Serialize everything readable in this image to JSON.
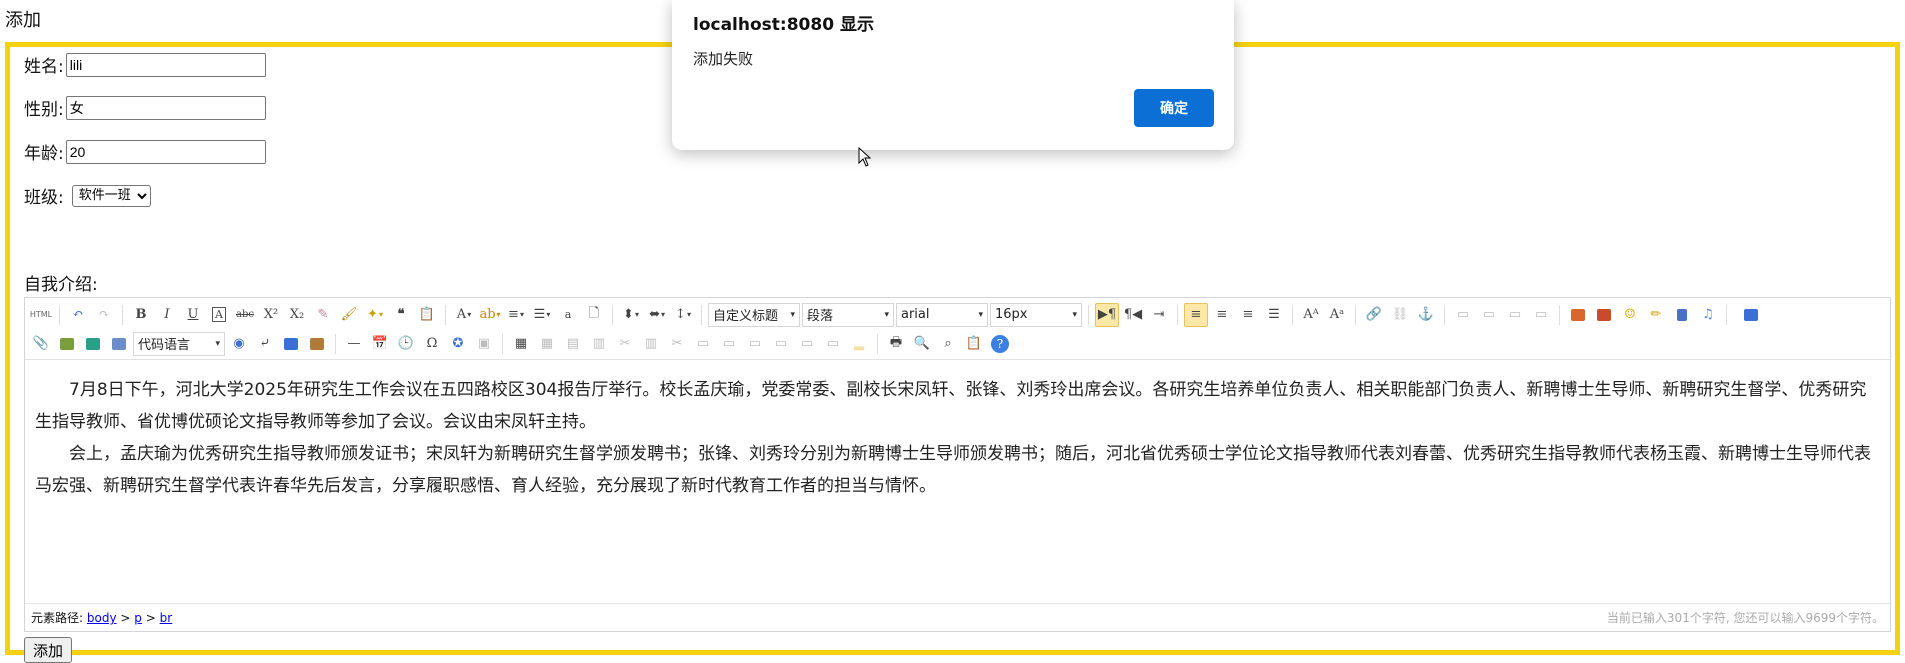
{
  "page": {
    "title": "添加"
  },
  "form": {
    "name_label": "姓名:",
    "name_value": "lili",
    "gender_label": "性别:",
    "gender_value": "女",
    "age_label": "年龄:",
    "age_value": "20",
    "class_label": "班级:",
    "class_selected": "软件一班",
    "intro_label": "自我介绍:",
    "submit_label": "添加",
    "frame_color": "#f5d20f"
  },
  "editor": {
    "toolbar": {
      "code_language_label": "代码语言",
      "custom_heading_label": "自定义标题",
      "paragraph_label": "段落",
      "font_family_label": "arial",
      "font_size_label": "16px",
      "html_icon_label": "HTML"
    },
    "content": {
      "paragraph1": "7月8日下午，河北大学2025年研究生工作会议在五四路校区304报告厅举行。校长孟庆瑜，党委常委、副校长宋凤轩、张锋、刘秀玲出席会议。各研究生培养单位负责人、相关职能部门负责人、新聘博士生导师、新聘研究生督学、优秀研究生指导教师、省优博优硕论文指导教师等参加了会议。会议由宋凤轩主持。",
      "paragraph2": "会上，孟庆瑜为优秀研究生指导教师颁发证书；宋凤轩为新聘研究生督学颁发聘书；张锋、刘秀玲分别为新聘博士生导师颁发聘书；随后，河北省优秀硕士学位论文指导教师代表刘春蕾、优秀研究生指导教师代表杨玉霞、新聘博士生导师代表马宏强、新聘研究生督学代表许春华先后发言，分享履职感悟、育人经验，充分展现了新时代教育工作者的担当与情怀。"
    },
    "footer": {
      "path_prefix": "元素路径:",
      "path_items": [
        "body",
        "p",
        "br"
      ],
      "path_sep": ">",
      "char_count": "当前已输入301个字符, 您还可以输入9699个字符。"
    }
  },
  "dialog": {
    "title": "localhost:8080 显示",
    "message": "添加失败",
    "ok_label": "确定",
    "ok_color": "#0b6fd6"
  }
}
